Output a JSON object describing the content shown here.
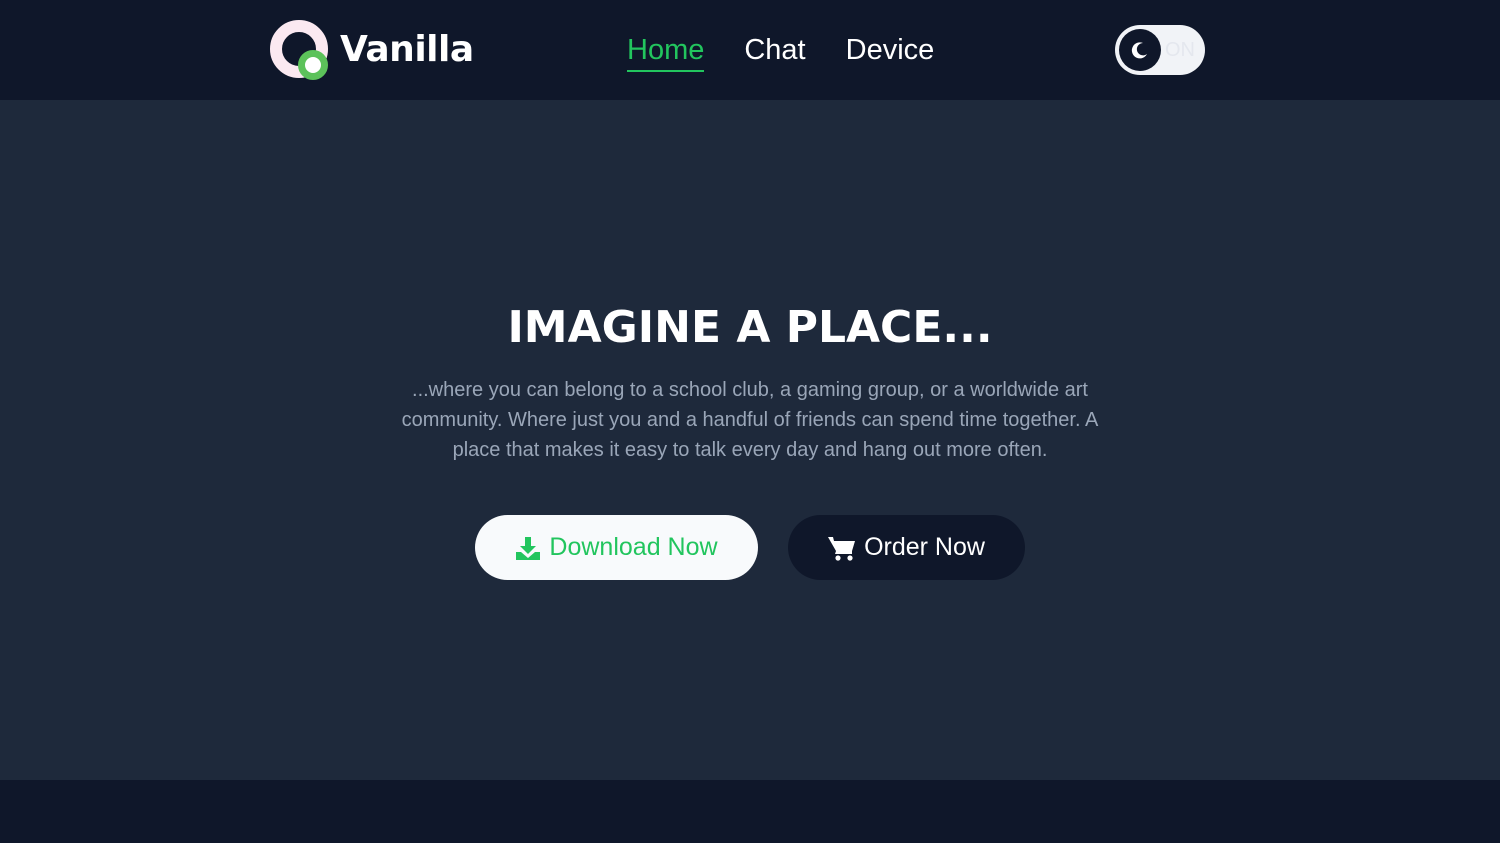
{
  "brand": {
    "name": "Vanilla",
    "mark_ring_color": "#fbe9f1",
    "mark_dot_color": "#5cc25a"
  },
  "nav": {
    "items": [
      {
        "label": "Home",
        "active": true
      },
      {
        "label": "Chat",
        "active": false
      },
      {
        "label": "Device",
        "active": false
      }
    ]
  },
  "theme_toggle": {
    "label": "ON",
    "icon": "moon-icon"
  },
  "hero": {
    "title": "IMAGINE A PLACE...",
    "description": "...where you can belong to a school club, a gaming group, or a worldwide art community. Where just you and a handful of friends can spend time together. A place that makes it easy to talk every day and hang out more often."
  },
  "actions": {
    "download": {
      "label": "Download Now",
      "icon": "download-icon"
    },
    "order": {
      "label": "Order Now",
      "icon": "cart-icon"
    }
  },
  "colors": {
    "accent": "#22c55e",
    "navbar_bg": "#0f172a",
    "hero_bg": "#1e293b",
    "muted_text": "#9aa6b8"
  }
}
